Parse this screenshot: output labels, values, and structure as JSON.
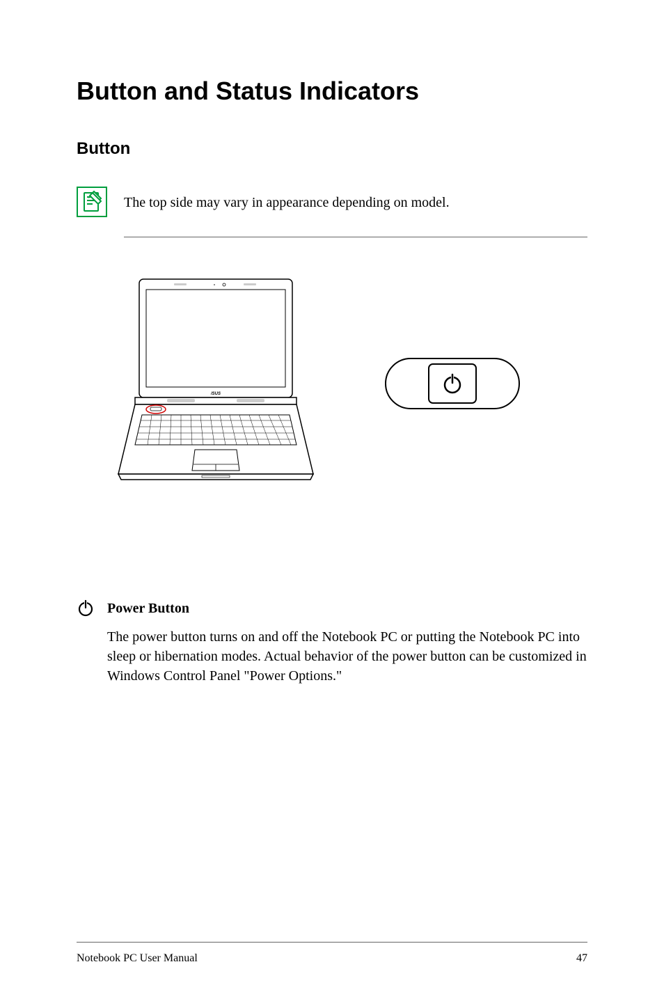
{
  "title": "Button and Status Indicators",
  "section": "Button",
  "note": {
    "text": "The top side may vary in appearance depending on model."
  },
  "subsection": {
    "title": "Power Button",
    "body": "The power button turns on and off the Notebook PC or putting the Notebook PC into sleep or hibernation modes. Actual behavior of the power button can be customized in Windows Control Panel \"Power Options.\""
  },
  "footer": {
    "left": "Notebook PC User Manual",
    "page": "47"
  }
}
